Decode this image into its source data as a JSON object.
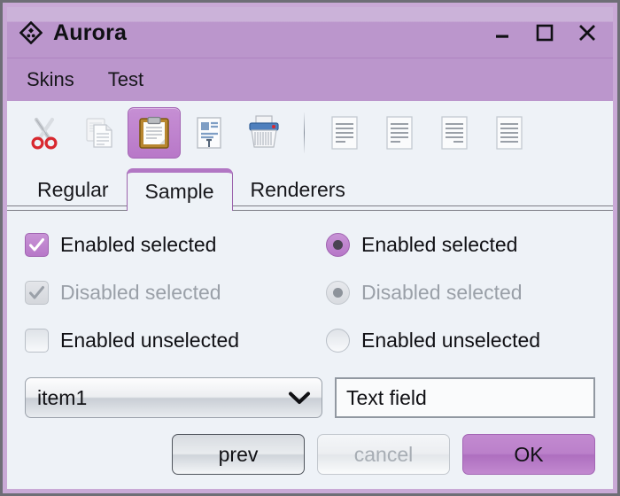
{
  "window": {
    "title": "Aurora",
    "logo_icon": "aurora-diamond-icon",
    "controls": [
      {
        "name": "minimize",
        "icon": "minimize-icon"
      },
      {
        "name": "maximize",
        "icon": "maximize-icon"
      },
      {
        "name": "close",
        "icon": "close-icon"
      }
    ]
  },
  "menubar": {
    "items": [
      {
        "label": "Skins"
      },
      {
        "label": "Test"
      }
    ]
  },
  "toolbar": {
    "buttons": [
      {
        "name": "cut",
        "icon": "scissors-icon",
        "selected": false
      },
      {
        "name": "copy",
        "icon": "copy-documents-icon",
        "selected": false
      },
      {
        "name": "paste",
        "icon": "clipboard-icon",
        "selected": true
      },
      {
        "name": "edit-document",
        "icon": "document-edit-icon",
        "selected": false
      },
      {
        "name": "delete",
        "icon": "shredder-icon",
        "selected": false
      },
      {
        "name": "align-left",
        "icon": "align-left-icon",
        "selected": false
      },
      {
        "name": "align-center",
        "icon": "align-center-icon",
        "selected": false
      },
      {
        "name": "align-right",
        "icon": "align-right-icon",
        "selected": false
      },
      {
        "name": "align-justify",
        "icon": "align-justify-icon",
        "selected": false
      }
    ]
  },
  "tabs": {
    "items": [
      {
        "label": "Regular",
        "selected": false
      },
      {
        "label": "Sample",
        "selected": true
      },
      {
        "label": "Renderers",
        "selected": false
      }
    ]
  },
  "panel": {
    "checkboxes": [
      {
        "label": "Enabled selected",
        "checked": true,
        "enabled": true
      },
      {
        "label": "Disabled selected",
        "checked": true,
        "enabled": false
      },
      {
        "label": "Enabled unselected",
        "checked": false,
        "enabled": true
      }
    ],
    "radios": [
      {
        "label": "Enabled selected",
        "checked": true,
        "enabled": true
      },
      {
        "label": "Disabled selected",
        "checked": true,
        "enabled": false
      },
      {
        "label": "Enabled unselected",
        "checked": false,
        "enabled": true
      }
    ],
    "combo": {
      "value": "item1",
      "chevron_icon": "chevron-down-icon"
    },
    "textfield": {
      "value": "Text field",
      "placeholder": ""
    }
  },
  "footer": {
    "buttons": [
      {
        "label": "prev",
        "state": "default"
      },
      {
        "label": "cancel",
        "state": "disabled"
      },
      {
        "label": "OK",
        "state": "accent"
      }
    ]
  },
  "colors": {
    "accent": "#b777c8",
    "titlebar_top": "#cbb2d9",
    "titlebar_bottom": "#bb96cc",
    "panel_bg": "#eef2f7",
    "window_border": "#6e6e76",
    "inner_border": "#c9a9d6",
    "disabled_text": "#9aa0a8"
  }
}
